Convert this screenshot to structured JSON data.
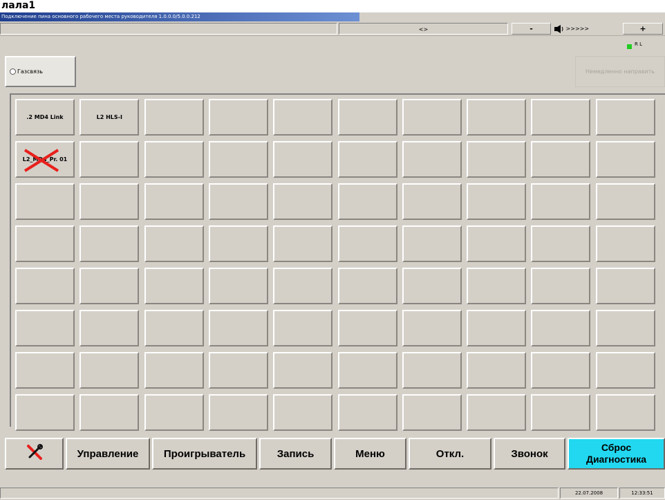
{
  "caption": "лала1",
  "title": "Подключение пина основного рабочего места руководителя 1.0.0.0/5.0.0.212",
  "toolbar": {
    "center_text": "<>",
    "minus": "-",
    "volume_text": ">>>>>",
    "plus": "+"
  },
  "indicator": {
    "label": "R  L",
    "color": "#22cc22"
  },
  "group_button": "Газсвязь",
  "disabled_button": "Немедленно направить",
  "grid": {
    "cells": [
      {
        "label": ".2 MD4 Link",
        "crossed": false
      },
      {
        "label": "L2 HLS-I",
        "crossed": false
      },
      {
        "label": "L2_MD4_Pr. 01",
        "crossed": true
      }
    ]
  },
  "bottom": {
    "tools_icon": "tools-icon",
    "control": "Управление",
    "player": "Проигрыватель",
    "record": "Запись",
    "menu": "Меню",
    "disconnect": "Откл.",
    "call": "Звонок",
    "reset": "Сброс",
    "diagnostics": "Диагностика"
  },
  "status": {
    "date": "22.07.2008",
    "time": "12:33:51"
  }
}
